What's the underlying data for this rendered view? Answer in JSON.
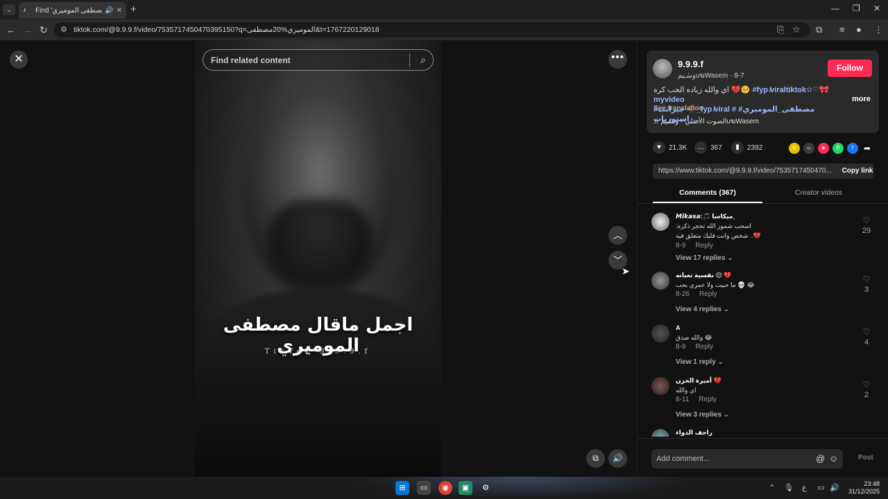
{
  "browser": {
    "tab_title": "Find 'مصطفى الموميري' on TikTok",
    "url": "tiktok.com/@9.9.9.f/video/7535717450470395150?q=الموميري%20مصطفى&t=1767220129018",
    "new_tab_label": "+",
    "minimize_label": "—",
    "restore_label": "❐",
    "close_label": "✕"
  },
  "video": {
    "search_placeholder": "Find related content",
    "overlay_caption": "اجمل ماقال مصطفى الموميري",
    "watermark": "TikTok 9.9.9.f"
  },
  "author": {
    "name": "9.9.9.f",
    "sub": "وسٰـيمuฆWasem · 8-7",
    "follow_label": "Follow",
    "description_prefix": "اي والله زياده الحب كره 💔🥺 ",
    "tags_line1": "#fyp ̸viraltiktok✫♡🎀 myvideo",
    "tags_line2": "#جيرانت 🥀_fyp ̸viral # مصطفى_الموميري# استوريات_...",
    "more_label": "more",
    "see_translation": "See translation",
    "music": "♫  الصوت الأصلي - وسٰـيمuฆWasem"
  },
  "stats": {
    "likes": "21.3K",
    "comments": "367",
    "saves": "2392"
  },
  "share": {
    "link": "https://www.tiktok.com/@9.9.9.f/video/7535717450470...",
    "copy_label": "Copy link"
  },
  "tabs": {
    "comments": "Comments (367)",
    "creator_videos": "Creator videos"
  },
  "comments": [
    {
      "user": "𝙈𝙞𝙠𝙖𝙨𝙖:🎵 ميكاسا ِ",
      "text1": ":اسحب شمور الله تحجر ذكره",
      "text2": "شخص وانت قلبك متعلق فيه ..💔",
      "date": "8-9",
      "reply": "Reply",
      "replies": "View 17 replies",
      "likes": "29"
    },
    {
      "user": "نفسية تعبانه 😔 💔",
      "text1": "ما حبيت ولا عمري بحب 💀 😂",
      "text2": "",
      "date": "8-26",
      "reply": "Reply",
      "replies": "View 4 replies",
      "likes": "3"
    },
    {
      "user": "A",
      "text1": "والله صدق 😂",
      "text2": "",
      "date": "8-9",
      "reply": "Reply",
      "replies": "View 1 reply",
      "likes": "4"
    },
    {
      "user": "أميرة الحزن 💔",
      "text1": "اي والله",
      "text2": "",
      "date": "8-11",
      "reply": "Reply",
      "replies": "View 3 replies",
      "likes": "2"
    },
    {
      "user": "راجف الدواء",
      "text1": "",
      "text2": "",
      "date": "",
      "reply": "",
      "replies": "",
      "likes": ""
    }
  ],
  "add_comment": {
    "placeholder": "Add comment...",
    "post_label": "Post"
  },
  "taskbar": {
    "time": "23:48",
    "date": "31/12/2025",
    "lang": "ع"
  },
  "colors": {
    "accent": "#fe2c55",
    "tag": "#9ab8ff"
  }
}
